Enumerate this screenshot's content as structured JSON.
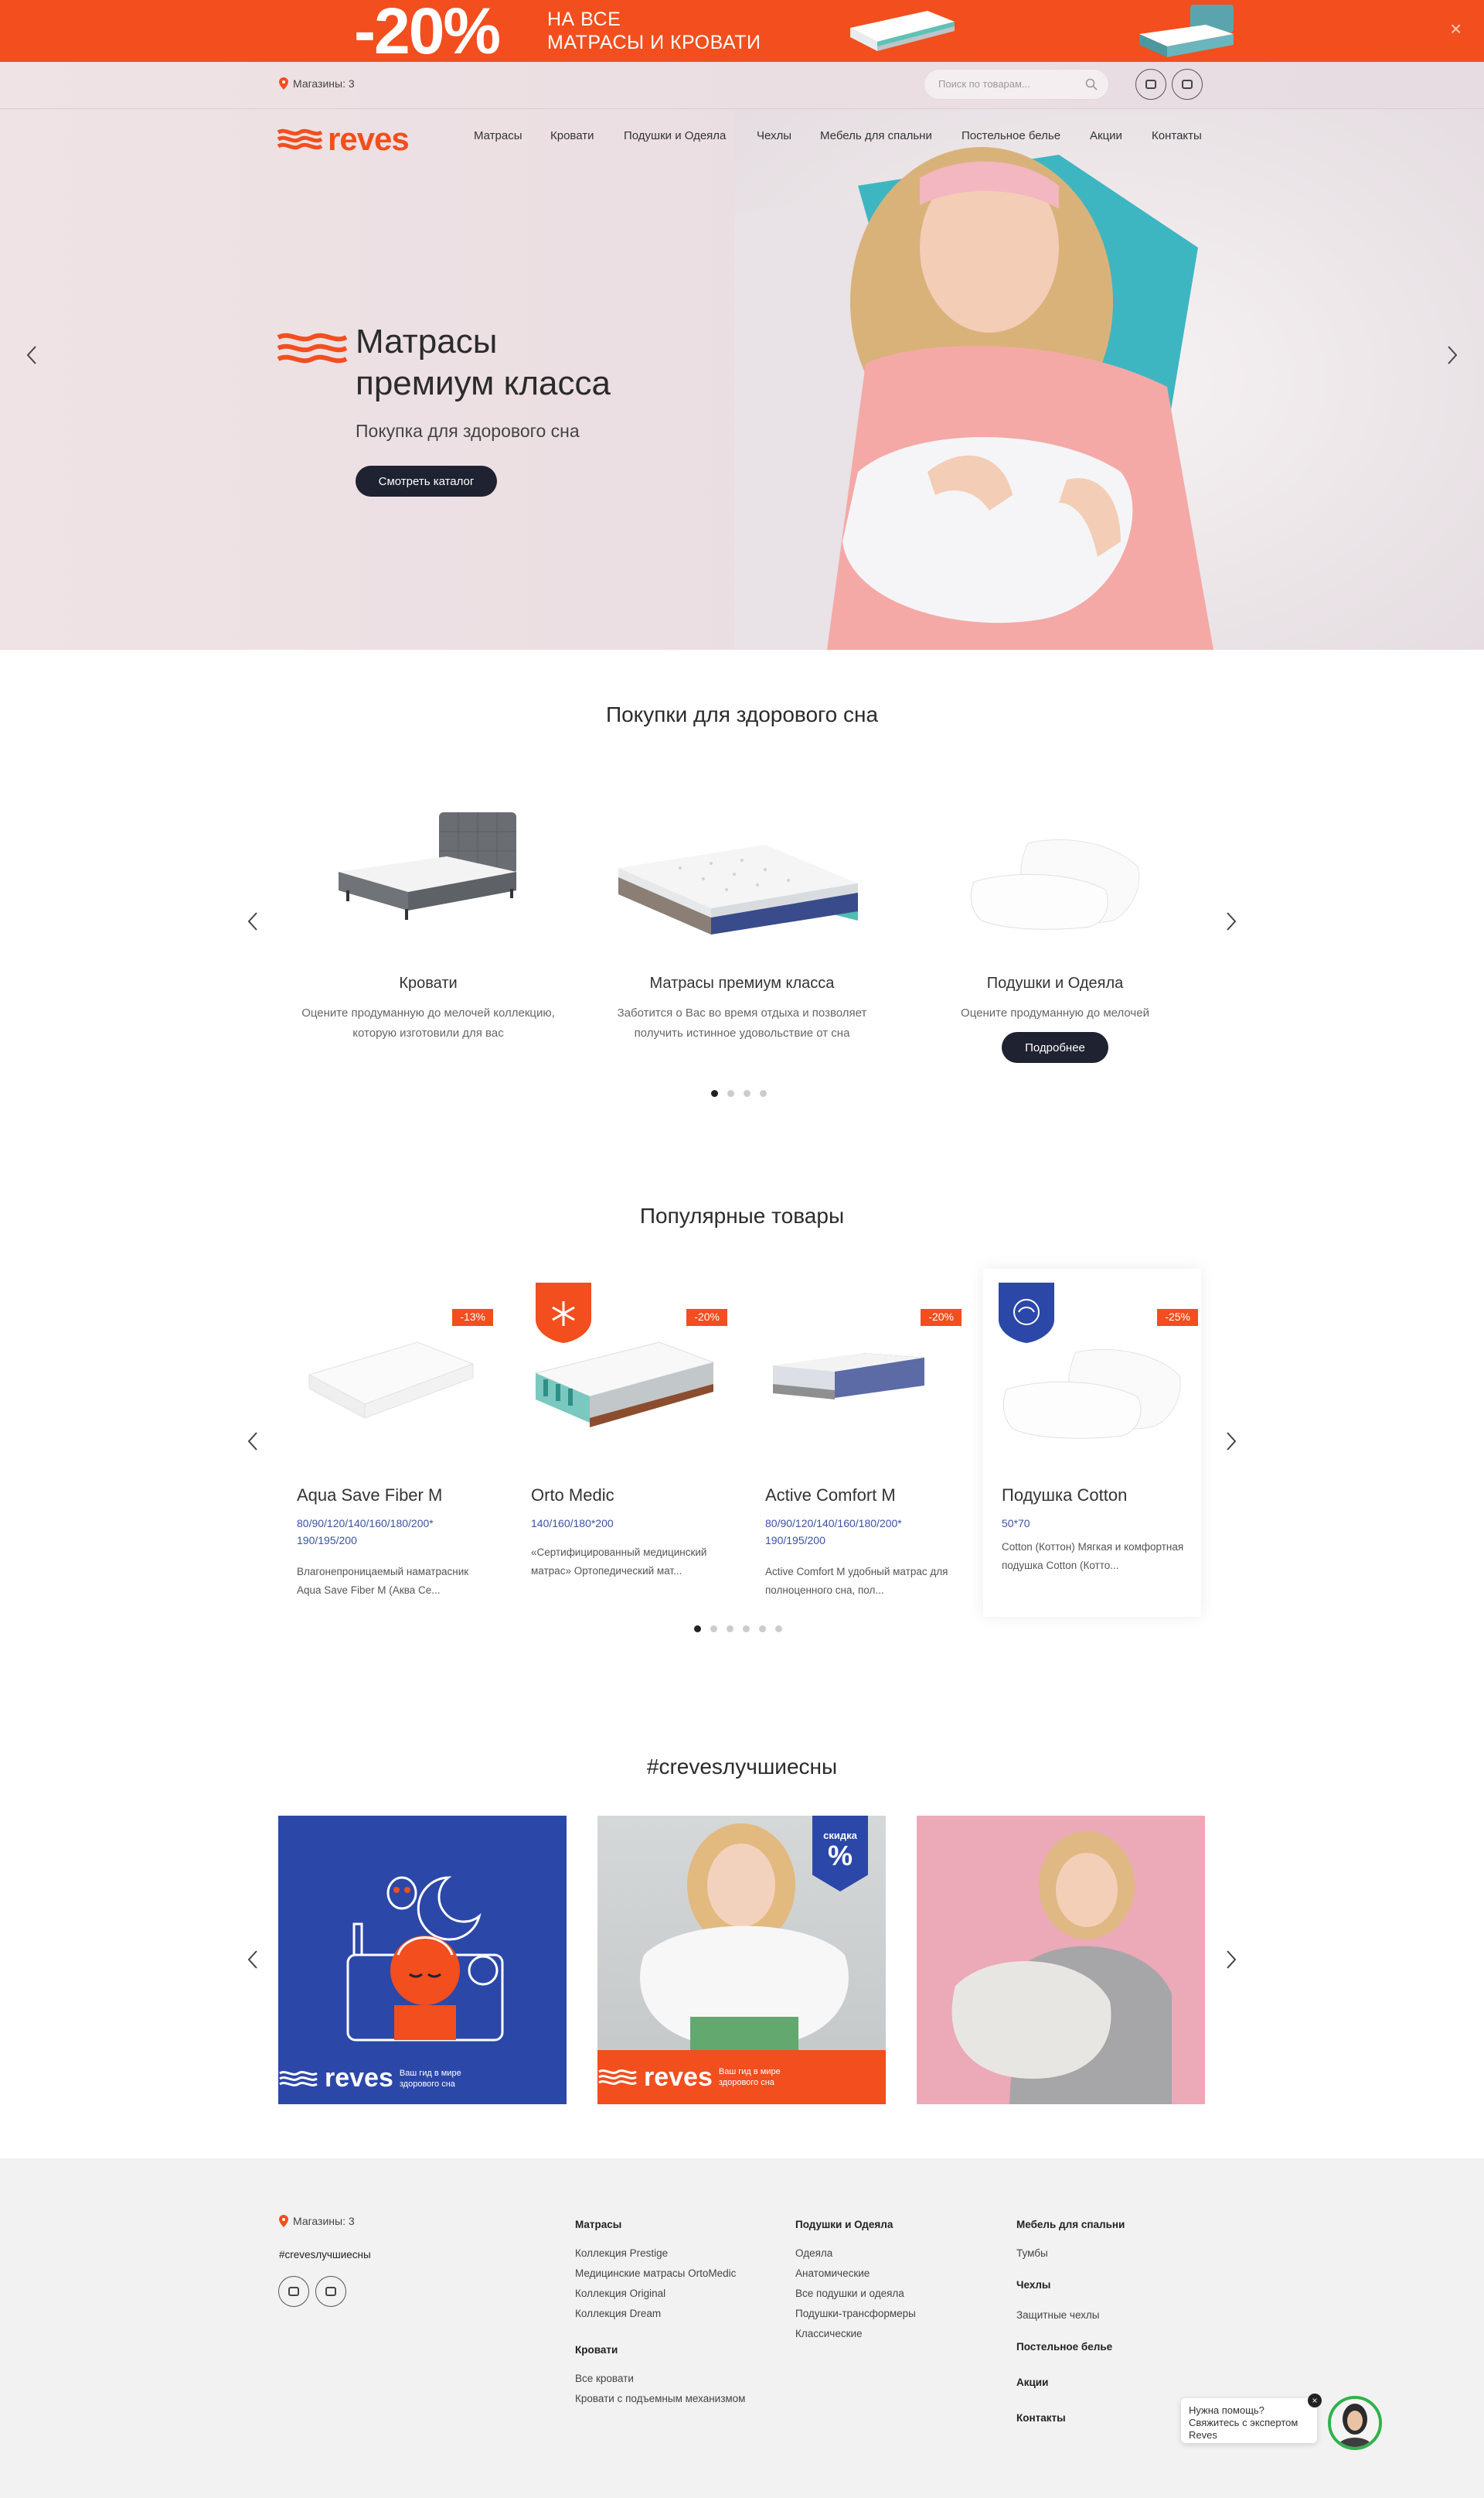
{
  "promo": {
    "percent": "-20%",
    "line1": "НА ВСЕ",
    "line2": "МАТРАСЫ И КРОВАТИ",
    "close": "×"
  },
  "topbar": {
    "stores": "Магазины: 3",
    "search_placeholder": "Поиск по товарам..."
  },
  "logo": "reves",
  "nav": [
    "Матрасы",
    "Кровати",
    "Подушки и Одеяла",
    "Чехлы",
    "Мебель для спальни",
    "Постельное белье",
    "Акции",
    "Контакты"
  ],
  "hero": {
    "title_line1": "Матрасы",
    "title_line2": "премиум класса",
    "subtitle": "Покупка для здорового сна",
    "cta": "Смотреть каталог"
  },
  "categories": {
    "title": "Покупки для здорового сна",
    "items": [
      {
        "name": "Кровати",
        "desc": "Оцените продуманную до мелочей коллекцию, которую изготовили для вас"
      },
      {
        "name": "Матрасы премиум класса",
        "desc": "Заботится о Вас во время отдыха и позволяет получить истинное удовольствие от сна"
      },
      {
        "name": "Подушки и Одеяла",
        "desc": "Оцените продуманную до мелочей",
        "button": "Подробнее"
      }
    ]
  },
  "popular": {
    "title": "Популярные товары",
    "items": [
      {
        "name": "Aqua Save Fiber M",
        "badge": "-13%",
        "sizes": "80/90/120/140/160/180/200* 190/195/200",
        "desc": "Влагонепроницаемый наматрасник Aqua Save Fiber M (Аква Се..."
      },
      {
        "name": "Orto Medic",
        "badge": "-20%",
        "sizes": "140/160/180*200",
        "desc": "«Сертифицированный медицинский матрас» Ортопедический мат..."
      },
      {
        "name": "Active Comfort M",
        "badge": "-20%",
        "sizes": "80/90/120/140/160/180/200* 190/195/200",
        "desc": "Active Comfort M удобный матрас для полноценного сна, пол..."
      },
      {
        "name": "Подушка Cotton",
        "badge": "-25%",
        "sizes": "50*70",
        "desc": "Cotton (Коттон) Мягкая и комфортная подушка Cotton (Котто..."
      }
    ]
  },
  "insta": {
    "title": "#crevesлучшиесны",
    "tile1_caption": "Ваш гид в мире здорового сна",
    "tile2_caption": "Ваш гид в мире здорового сна",
    "tile2_badge": "скидка",
    "tile2_pct": "%"
  },
  "footer": {
    "stores": "Магазины: 3",
    "hashtag": "#crevesлучшиесны",
    "col1_h": "Матрасы",
    "col1": [
      "Коллекция Prestige",
      "Медицинские матрасы OrtoMedic",
      "Коллекция Original",
      "Коллекция Dream"
    ],
    "col1b_h": "Кровати",
    "col1b": [
      "Все кровати",
      "Кровати с подъемным механизмом"
    ],
    "col2_h": "Подушки и Одеяла",
    "col2": [
      "Одеяла",
      "Анатомические",
      "Все подушки и одеяла",
      "Подушки-трансформеры",
      "Классические"
    ],
    "col3_h1": "Мебель для спальни",
    "col3_l1": "Тумбы",
    "col3_h2": "Чехлы",
    "col3_l2": "Защитные чехлы",
    "col3_h3": "Постельное белье",
    "col3_h4": "Акции",
    "col3_h5": "Контакты"
  },
  "chat": {
    "text1": "Нужна помощь?",
    "text2": "Свяжитесь с экспертом",
    "text3": "Reves",
    "close": "×"
  },
  "colors": {
    "brand": "#f24e1e",
    "dark": "#1f2230",
    "blue": "#2b47a8"
  }
}
